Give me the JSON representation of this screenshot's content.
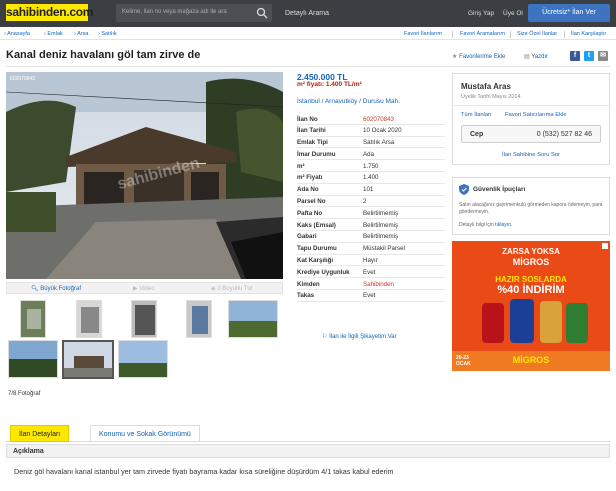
{
  "header": {
    "logo": "sahibinden.com",
    "search_placeholder": "Kelime, ilan no veya mağaza adı ile ara",
    "advanced_search": "Detaylı Arama",
    "login": "Giriş Yap",
    "register": "Üye Ol",
    "free_ad": "Ücretsiz* İlan Ver"
  },
  "breadcrumb": [
    "Anasayfa",
    "Emlak",
    "Arsa",
    "Satılık"
  ],
  "top_links": [
    "Favori İlanlarım",
    "Favori Aramalarım",
    "Size Özel İlanlar",
    "İlan Karşılaştır"
  ],
  "listing": {
    "title": "Kanal deniz havalanı göl tam zirve de",
    "add_favorite": "Favorilerime Ekle",
    "print": "Yazdır",
    "photo_watermark": "602070843",
    "photo_actions": {
      "large": "Büyük Fotoğraf",
      "video": "Video",
      "virtual": "3 Boyutlu Tur"
    },
    "photo_count": "7/8 Fotoğraf",
    "price": "2.450.000 TL",
    "m2_price": "m² fiyatı: 1.400 TL/m²",
    "location": [
      "İstanbul",
      "Arnavutköy",
      "Durusu Mah."
    ],
    "details": [
      {
        "key": "İlan No",
        "value": "602070843",
        "red": true
      },
      {
        "key": "İlan Tarihi",
        "value": "10 Ocak 2020"
      },
      {
        "key": "Emlak Tipi",
        "value": "Satılık Arsa"
      },
      {
        "key": "İmar Durumu",
        "value": "Ada"
      },
      {
        "key": "m²",
        "value": "1.750"
      },
      {
        "key": "m² Fiyatı",
        "value": "1.400"
      },
      {
        "key": "Ada No",
        "value": "101"
      },
      {
        "key": "Parsel No",
        "value": "2"
      },
      {
        "key": "Pafta No",
        "value": "Belirtilmemiş"
      },
      {
        "key": "Kaks (Emsal)",
        "value": "Belirtilmemiş"
      },
      {
        "key": "Gabari",
        "value": "Belirtilmemiş"
      },
      {
        "key": "Tapu Durumu",
        "value": "Müstakil Parsel"
      },
      {
        "key": "Kat Karşılığı",
        "value": "Hayır"
      },
      {
        "key": "Krediye Uygunluk",
        "value": "Evet"
      },
      {
        "key": "Kimden",
        "value": "Sahibinden",
        "red": true
      },
      {
        "key": "Takas",
        "value": "Evet"
      }
    ],
    "complain": "İlan ile İlgili Şikayetim Var"
  },
  "seller": {
    "name": "Mustafa Aras",
    "since": "Üyelik Tarihi  Mayıs 2014",
    "all_ads": "Tüm İlanları",
    "add_fav_seller": "Favori Satıcılarıma Ekle",
    "phone_label": "Cep",
    "phone": "0 (532) 527 82 46",
    "ask": "İlan Sahibine Soru Sor"
  },
  "safety": {
    "title": "Güvenlik İpuçları",
    "text": "Satın alacağınız gayrimenkulü görmeden kapora ödemeyin, para göndermeyin.",
    "detail_prefix": "Detaylı bilgi için",
    "detail_link": "tıklayın."
  },
  "ad": {
    "line1": "ZARSA YOKSA",
    "brand": "MİGROS",
    "line2": "HAZIR SOSLARDA",
    "discount": "%40 İNDİRİM",
    "dates": "20-23 OCAK",
    "footer": "MİGROS"
  },
  "tabs": [
    "İlan Detayları",
    "Konumu ve Sokak Görünümü"
  ],
  "description": {
    "heading": "Açıklama",
    "text": "Deniz göl havalanı kanal istanbul yer tam zirvede fiyatı bayrama kadar kısa süreliğine düşürdüm 4/1 takas kabul ederim"
  },
  "colors": {
    "brand_yellow": "#ffe800",
    "header_bg": "#3b3e43",
    "link_blue": "#1064bc",
    "button_blue": "#3d74c2"
  }
}
